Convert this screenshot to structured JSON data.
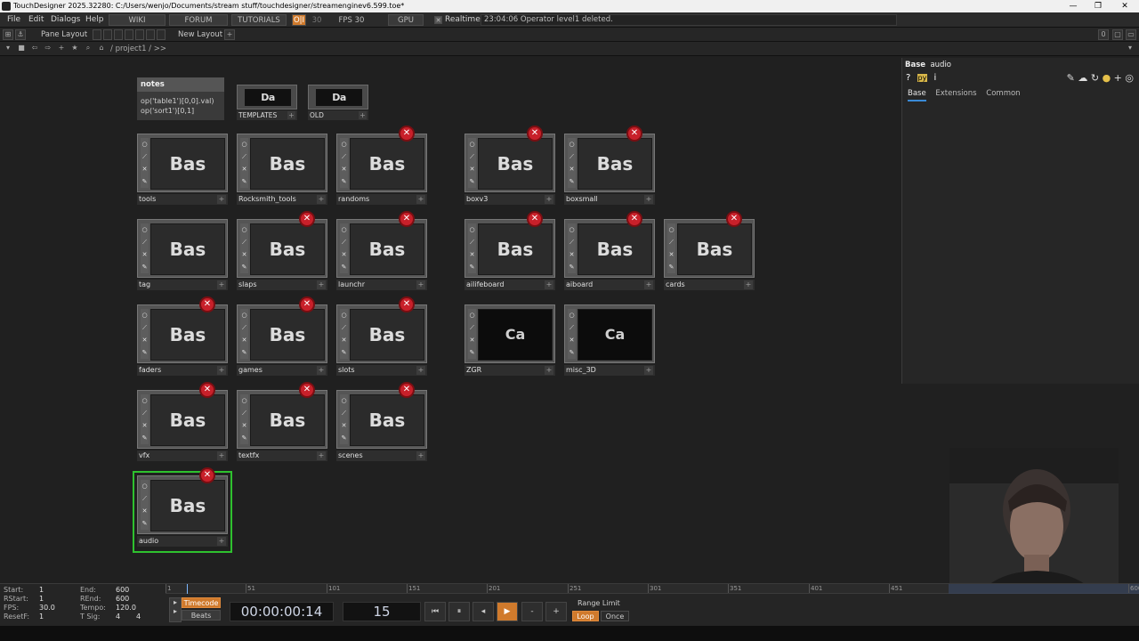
{
  "window": {
    "title": "TouchDesigner 2025.32280: C:/Users/wenjo/Documents/stream stuff/touchdesigner/streamenginev6.599.toe*",
    "minimize": "—",
    "restore": "❐",
    "close": "✕"
  },
  "menu": {
    "file": "File",
    "edit": "Edit",
    "dialogs": "Dialogs",
    "help": "Help",
    "wiki": "WIKI",
    "forum": "FORUM",
    "tutorials": "TUTORIALS",
    "perf_on": "O|I",
    "perf_val": "30",
    "fps": "FPS  30",
    "gpu": "GPU",
    "realtime": "Realtime",
    "status_message": "23:04:06 Operator level1 deleted."
  },
  "panebar": {
    "pane_layout": "Pane Layout",
    "new_layout": "New Layout",
    "plus": "+",
    "counter": "0"
  },
  "pathbar": {
    "path": "/ project1 / >>"
  },
  "notes": {
    "title": "notes",
    "line1": "op('table1')[0,0].val)",
    "line2": "op('sort1')[0,1]"
  },
  "small_comps": [
    {
      "label": "TEMPLATES",
      "preview": "Da"
    },
    {
      "label": "OLD",
      "preview": "Da"
    }
  ],
  "nodes": [
    {
      "label": "tools",
      "preview": "Bas"
    },
    {
      "label": "Rocksmith_tools",
      "preview": "Bas"
    },
    {
      "label": "randoms",
      "preview": "Bas"
    },
    {
      "label": "boxv3",
      "preview": "Bas"
    },
    {
      "label": "boxsmall",
      "preview": "Bas"
    },
    {
      "label": "tag",
      "preview": "Bas"
    },
    {
      "label": "slaps",
      "preview": "Bas"
    },
    {
      "label": "launchr",
      "preview": "Bas"
    },
    {
      "label": "ailifeboard",
      "preview": "Bas"
    },
    {
      "label": "aiboard",
      "preview": "Bas"
    },
    {
      "label": "cards",
      "preview": "Bas"
    },
    {
      "label": "faders",
      "preview": "Bas"
    },
    {
      "label": "games",
      "preview": "Bas"
    },
    {
      "label": "slots",
      "preview": "Bas"
    },
    {
      "label": "ZGR",
      "preview": "Ca"
    },
    {
      "label": "misc_3D",
      "preview": "Ca"
    },
    {
      "label": "vfx",
      "preview": "Bas"
    },
    {
      "label": "textfx",
      "preview": "Bas"
    },
    {
      "label": "scenes",
      "preview": "Bas"
    },
    {
      "label": "audio",
      "preview": "Bas"
    }
  ],
  "params": {
    "type": "Base",
    "name": "audio",
    "tab_base": "Base",
    "tab_extensions": "Extensions",
    "tab_common": "Common"
  },
  "timeline": {
    "start_k": "Start:",
    "start_v": "1",
    "rstart_k": "RStart:",
    "rstart_v": "1",
    "fps_k": "FPS:",
    "fps_v": "30.0",
    "resetf_k": "ResetF:",
    "resetf_v": "1",
    "end_k": "End:",
    "end_v": "600",
    "rend_k": "REnd:",
    "rend_v": "600",
    "tempo_k": "Tempo:",
    "tempo_v": "120.0",
    "tsig_k": "T Sig:",
    "tsig_v1": "4",
    "tsig_v2": "4",
    "ticks": [
      "1",
      "51",
      "101",
      "151",
      "201",
      "251",
      "301",
      "351",
      "401",
      "451",
      "600"
    ],
    "timecode_btn": "Timecode",
    "beats_btn": "Beats",
    "timecode": "00:00:00:14",
    "frame": "15",
    "range_limit": "Range Limit",
    "loop": "Loop",
    "once": "Once",
    "minus": "-",
    "plus": "+"
  }
}
